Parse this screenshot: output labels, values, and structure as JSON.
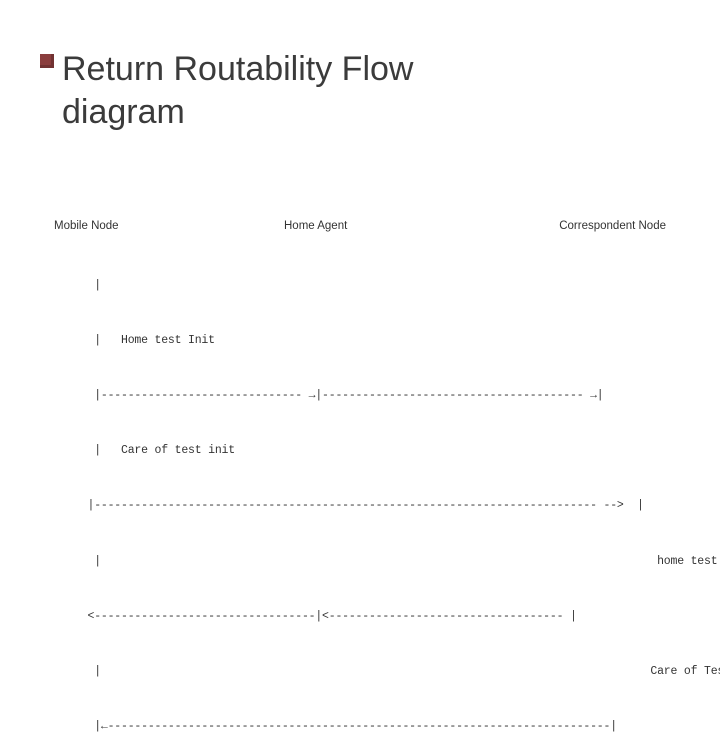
{
  "title_line1": "Return Routability Flow",
  "title_line2": "diagram",
  "headers": {
    "left": "Mobile Node",
    "mid": "Home Agent",
    "right": "Correspondent Node"
  },
  "flow_lines": [
    "      |                                                                                                                    |",
    "      |   Home test Init                                                                                            |",
    "      |------------------------------ →|--------------------------------------- →|",
    "      |   Care of test init                                                                                          |",
    "     |--------------------------------------------------------------------------- -->  |",
    "      |                                                                                   home test      |",
    "     <---------------------------------|<----------------------------------- |",
    "      |                                                                                  Care of Test        |",
    "      |←---------------------------------------------------------------------------|"
  ]
}
